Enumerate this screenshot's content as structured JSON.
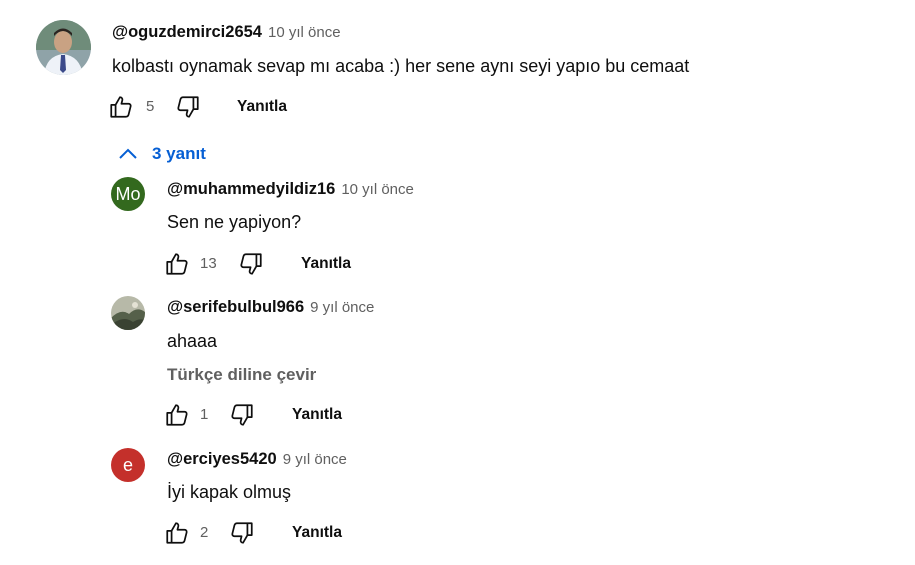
{
  "comment": {
    "author": "@oguzdemirci2654",
    "time": "10 yıl önce",
    "text": "kolbastı oynamak sevap mı acaba :) her sene aynı seyi yapıo bu cemaat",
    "likes": "5",
    "reply_label": "Yanıtla",
    "avatar_icon": "person-photo"
  },
  "replies_toggle": {
    "label": "3 yanıt",
    "icon": "chevron-up-icon",
    "color": "#065fd4"
  },
  "replies": [
    {
      "author": "@muhammedyildiz16",
      "time": "10 yıl önce",
      "text": "Sen ne yapiyon?",
      "likes": "13",
      "reply_label": "Yanıtla",
      "avatar_letter": "Mo",
      "avatar_color": "#33691e"
    },
    {
      "author": "@serifebulbul966",
      "time": "9 yıl önce",
      "text": "ahaaa",
      "translate_label": "Türkçe diline çevir",
      "likes": "1",
      "reply_label": "Yanıtla",
      "avatar_icon": "landscape-photo"
    },
    {
      "author": "@erciyes5420",
      "time": "9 yıl önce",
      "text": "İyi kapak olmuş",
      "likes": "2",
      "reply_label": "Yanıtla",
      "avatar_letter": "e",
      "avatar_color": "#c4302b"
    }
  ]
}
